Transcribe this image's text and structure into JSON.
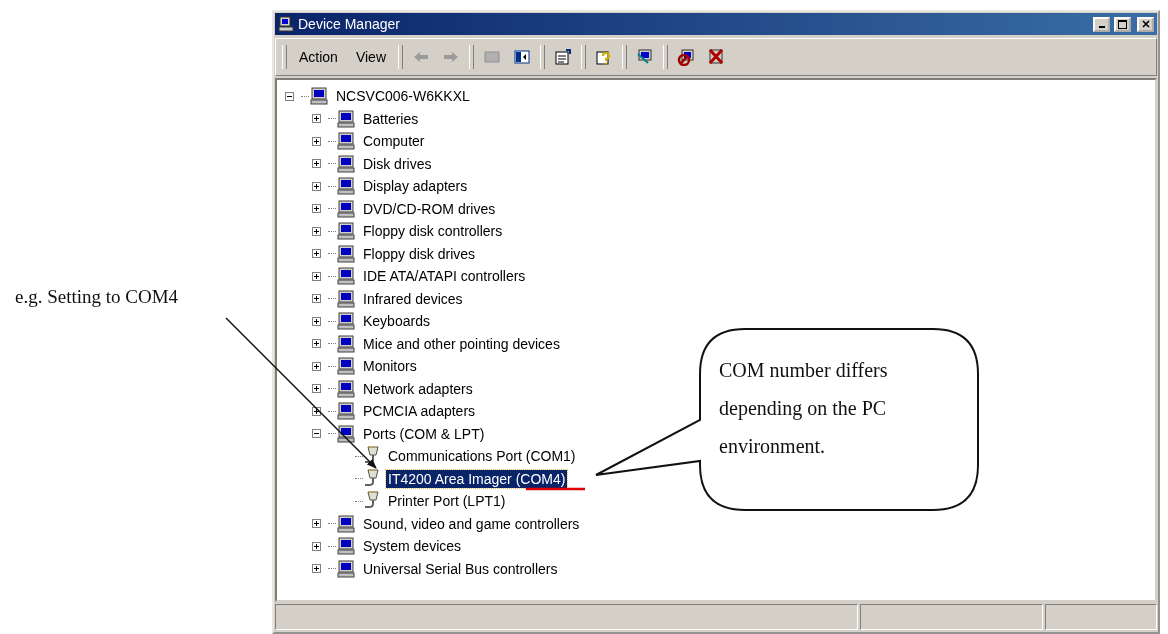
{
  "window": {
    "title": "Device Manager"
  },
  "menus": [
    {
      "label": "Action"
    },
    {
      "label": "View"
    }
  ],
  "tree": {
    "label": "NCSVC006-W6KKXL",
    "expanded": true,
    "selected": false,
    "children": [
      {
        "label": "Batteries",
        "expanded": false,
        "selected": false
      },
      {
        "label": "Computer",
        "expanded": false,
        "selected": false
      },
      {
        "label": "Disk drives",
        "expanded": false,
        "selected": false
      },
      {
        "label": "Display adapters",
        "expanded": false,
        "selected": false
      },
      {
        "label": "DVD/CD-ROM drives",
        "expanded": false,
        "selected": false
      },
      {
        "label": "Floppy disk controllers",
        "expanded": false,
        "selected": false
      },
      {
        "label": "Floppy disk drives",
        "expanded": false,
        "selected": false
      },
      {
        "label": "IDE ATA/ATAPI controllers",
        "expanded": false,
        "selected": false
      },
      {
        "label": "Infrared devices",
        "expanded": false,
        "selected": false
      },
      {
        "label": "Keyboards",
        "expanded": false,
        "selected": false
      },
      {
        "label": "Mice and other pointing devices",
        "expanded": false,
        "selected": false
      },
      {
        "label": "Monitors",
        "expanded": false,
        "selected": false
      },
      {
        "label": "Network adapters",
        "expanded": false,
        "selected": false
      },
      {
        "label": "PCMCIA adapters",
        "expanded": false,
        "selected": false
      },
      {
        "label": "Ports (COM & LPT)",
        "expanded": true,
        "selected": false,
        "children": [
          {
            "label": "Communications Port (COM1)",
            "selected": false
          },
          {
            "label": "IT4200 Area Imager (COM4)",
            "selected": true
          },
          {
            "label": "Printer Port (LPT1)",
            "selected": false
          }
        ]
      },
      {
        "label": "Sound, video and game controllers",
        "expanded": false,
        "selected": false
      },
      {
        "label": "System devices",
        "expanded": false,
        "selected": false
      },
      {
        "label": "Universal Serial Bus controllers",
        "expanded": false,
        "selected": false
      }
    ]
  },
  "annotations": {
    "note": "e.g. Setting to COM4",
    "callout": "COM number differs depending on the PC environment."
  }
}
